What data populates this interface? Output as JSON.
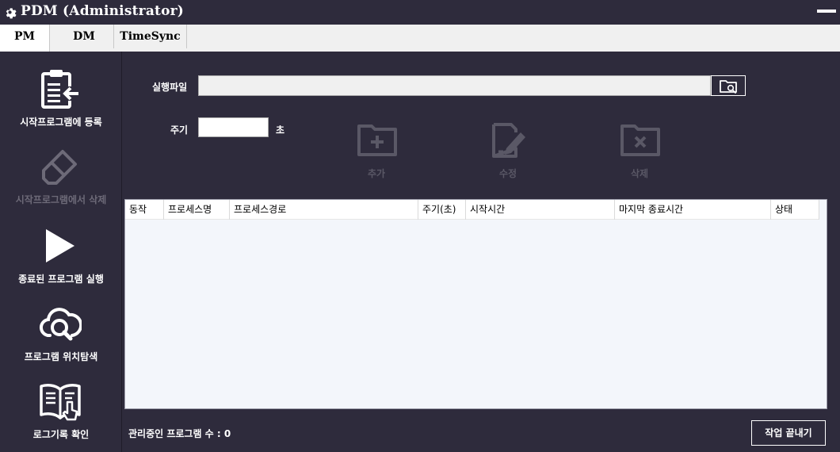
{
  "window": {
    "title": "PDM (Administrator)",
    "icon": "gear-icon",
    "minimize_icon": "minimize-icon"
  },
  "tabs": [
    {
      "label": "PM",
      "active": true
    },
    {
      "label": "DM",
      "active": false
    },
    {
      "label": "TimeSync",
      "active": false
    }
  ],
  "sidebar": {
    "items": [
      {
        "label": "시작프로그램에 등록",
        "icon": "clipboard-import-icon",
        "enabled": true
      },
      {
        "label": "시작프로그램에서 삭제",
        "icon": "eraser-icon",
        "enabled": false
      },
      {
        "label": "종료된 프로그램 실행",
        "icon": "play-icon",
        "enabled": true
      },
      {
        "label": "프로그램 위치탐색",
        "icon": "cloud-search-icon",
        "enabled": true
      },
      {
        "label": "로그기록 확인",
        "icon": "book-pointer-icon",
        "enabled": true
      }
    ]
  },
  "form": {
    "exec_file_label": "실행파일",
    "exec_file_value": "",
    "browse_icon": "folder-search-icon",
    "cycle_label": "주기",
    "cycle_value": "",
    "cycle_unit": "초"
  },
  "actions": [
    {
      "label": "추가",
      "icon": "folder-add-icon",
      "enabled": false
    },
    {
      "label": "수정",
      "icon": "file-edit-icon",
      "enabled": false
    },
    {
      "label": "삭제",
      "icon": "folder-delete-icon",
      "enabled": false
    }
  ],
  "table": {
    "columns": [
      "동작",
      "프로세스명",
      "프로세스경로",
      "주기(초)",
      "시작시간",
      "마지막 종료시간",
      "상태"
    ],
    "rows": []
  },
  "footer": {
    "managed_count_label": "관리중인 프로그램 수 : 0",
    "finish_button": "작업 끝내기"
  },
  "colors": {
    "background": "#2e2b3c",
    "disabled_text": "#5a5866",
    "table_bg": "#f3f6fb"
  }
}
